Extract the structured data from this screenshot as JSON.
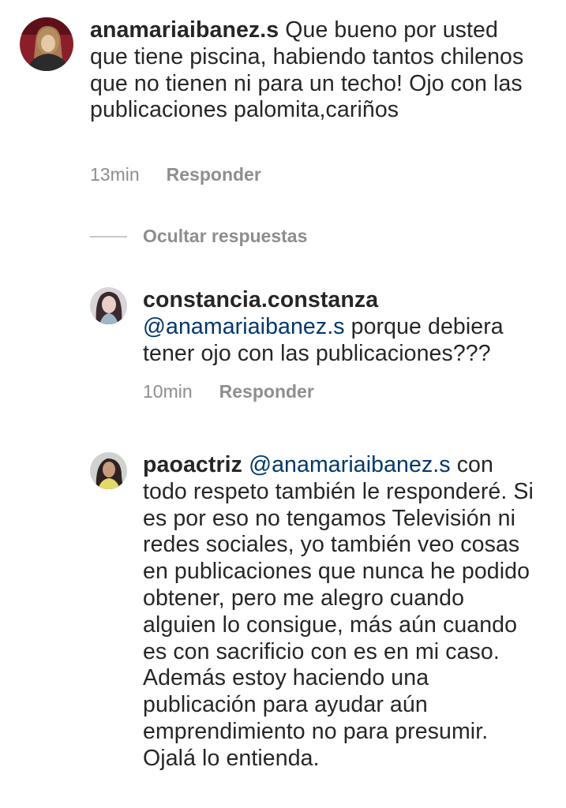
{
  "comments": [
    {
      "username": "anamariaibanez.s",
      "text": " Que bueno por usted que tiene piscina, habiendo tantos chilenos que no tienen ni para un techo! Ojo con las publicaciones palomita,cariños",
      "time": "13min",
      "reply_label": "Responder"
    }
  ],
  "hide_replies_label": "Ocultar respuestas",
  "replies": [
    {
      "username": "constancia.constanza",
      "mention": "@anamariaibanez.s",
      "text": " porque debiera tener ojo con las publicaciones???",
      "time": "10min",
      "reply_label": "Responder"
    },
    {
      "username": "paoactriz",
      "mention": "@anamariaibanez.s",
      "text": " con todo respeto también le responderé. Si es por eso no tengamos Televisión ni redes sociales, yo también veo cosas en publicaciones que nunca he podido obtener, pero me alegro cuando alguien lo consigue, más aún cuando es con sacrificio con es en mi caso. Además estoy haciendo una publicación para ayudar aún emprendimiento no para presumir. Ojalá lo entienda."
    }
  ],
  "colors": {
    "text": "#262626",
    "secondary": "#8e8e8e",
    "mention": "#00376b",
    "divider": "#c7c7c7"
  }
}
